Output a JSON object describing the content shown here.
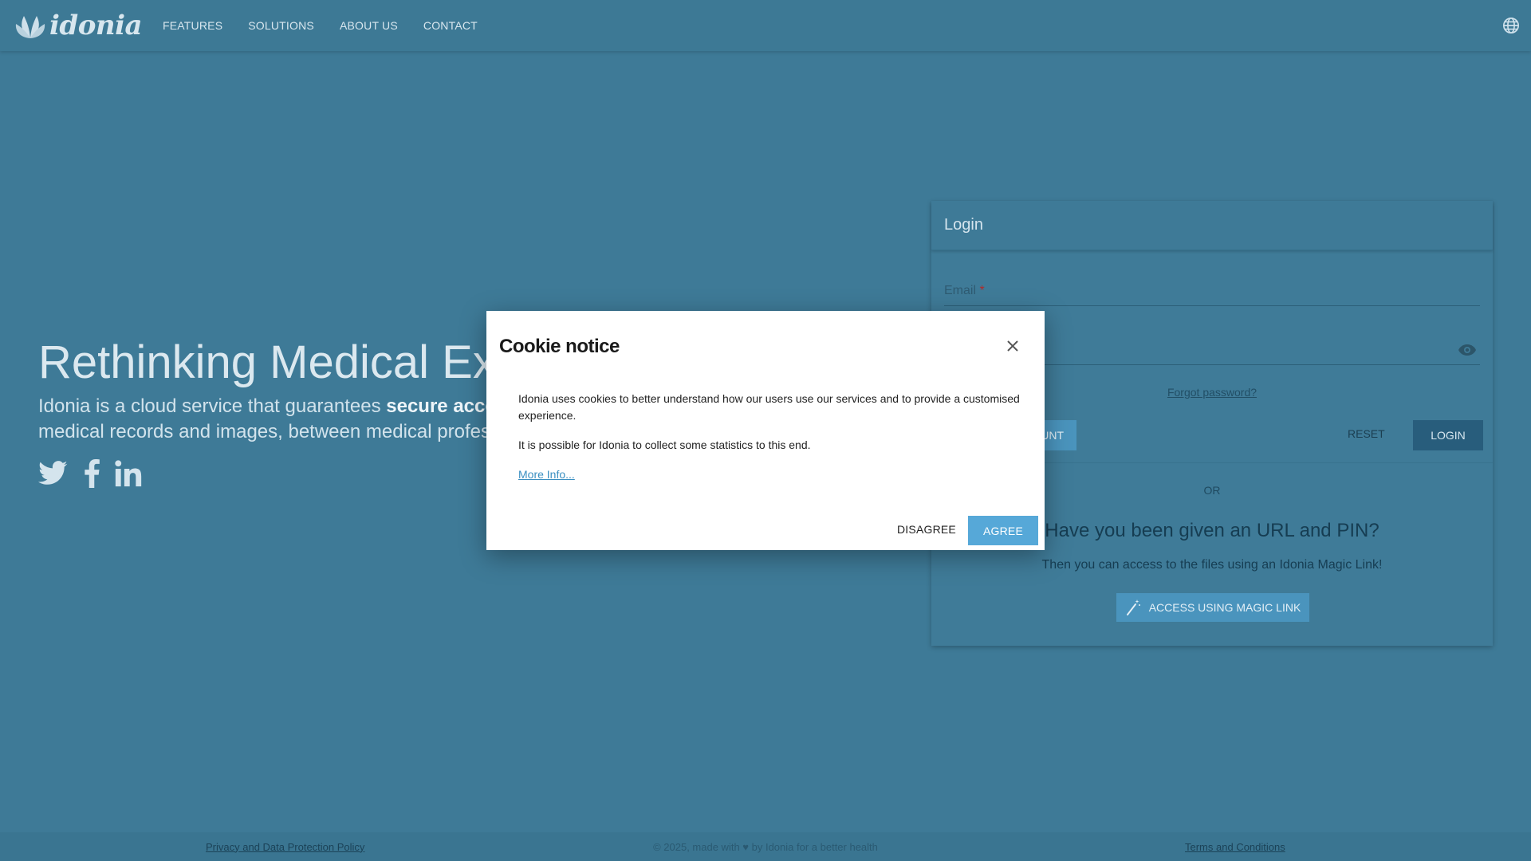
{
  "brand": {
    "logo_text": "idonia"
  },
  "nav": {
    "items": [
      {
        "label": "FEATURES"
      },
      {
        "label": "SOLUTIONS"
      },
      {
        "label": "ABOUT US"
      },
      {
        "label": "CONTACT"
      }
    ],
    "language_icon": "globe-icon"
  },
  "hero": {
    "title": "Rethinking Medical Exch",
    "subtitle_line1_prefix": "Idonia is a cloud service that guarantees ",
    "subtitle_line1_bold": "secure acce",
    "subtitle_line2": "medical records and images, between medical profes",
    "social_icons": [
      "twitter-icon",
      "facebook-icon",
      "linkedin-icon"
    ]
  },
  "login": {
    "title": "Login",
    "email_label": "Email",
    "required_mark": "*",
    "forgot_password": "Forgot password?",
    "create_account_fragment": "UNT",
    "reset_label": "RESET",
    "login_label": "LOGIN",
    "or_text": "OR",
    "pin_title": "Have you been given an URL and PIN?",
    "pin_subtitle": "Then you can access to the files using an Idonia Magic Link!",
    "magic_link_label": "ACCESS USING MAGIC LINK"
  },
  "footer": {
    "privacy": "Privacy and Data Protection Policy",
    "copyright": "© 2025, made with ♥ by Idonia for a better health",
    "terms": "Terms and Conditions"
  },
  "cookie_modal": {
    "title": "Cookie notice",
    "paragraph1": "Idonia uses cookies to better understand how our users use our services and to provide a customised experience.",
    "paragraph2": "It is possible for Idonia to collect some statistics to this end.",
    "more_info": "More Info...",
    "disagree_label": "DISAGREE",
    "agree_label": "AGREE"
  },
  "colors": {
    "background": "#3e7a97",
    "login_button": "#285d7c",
    "agree_button": "#56a8d8",
    "link": "#3a8fc1"
  }
}
